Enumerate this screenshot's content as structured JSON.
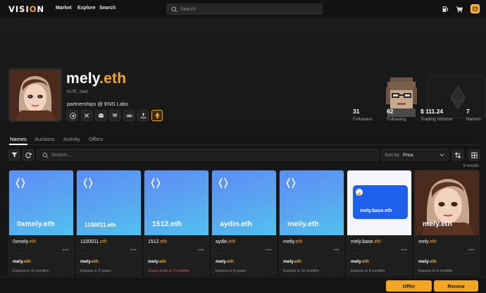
{
  "nav": {
    "logo_prefix": "VISI",
    "logo_o": "O",
    "logo_suffix": "N",
    "links": [
      "Market",
      "Explore",
      "Search"
    ],
    "search_placeholder": "Search",
    "icons": [
      "gas-icon",
      "cart-icon",
      "wallet-icon"
    ]
  },
  "profile": {
    "name": "mely",
    "tld": ".eth",
    "address": "0x7ff...2bef",
    "bio": "partnerships @ ENS Labs",
    "socials": [
      "telegram-icon",
      "x-icon",
      "discord-icon",
      "warpcast-icon",
      "link-icon",
      "share-icon",
      "ethereum-icon"
    ],
    "social_glyphs": [
      "W"
    ]
  },
  "stats": [
    {
      "value": "31",
      "label": "Followers"
    },
    {
      "value": "62",
      "label": "Following"
    },
    {
      "value": "$ 111.24",
      "label": "Trading Volume"
    },
    {
      "value": "7",
      "label": "Names"
    }
  ],
  "tabs": [
    "Names",
    "Auctions",
    "Activity",
    "Offers"
  ],
  "active_tab": "Names",
  "toolbar": {
    "search_placeholder": "Search...",
    "sort_label": "Sort by:",
    "sort_value": "Price"
  },
  "results_text": "9 results",
  "cards": [
    {
      "image_label": "0xmely.eth",
      "name": "0xmely",
      "tld": ".eth",
      "owner": "mely",
      "owner_tld": ".eth",
      "expiry": "Expires in 11 months",
      "grace": false
    },
    {
      "image_label": "1100011.eth",
      "name": "1100011",
      "tld": ".eth",
      "owner": "mely",
      "owner_tld": ".eth",
      "expiry": "Expires in 2 years",
      "grace": false
    },
    {
      "image_label": "1512.eth",
      "name": "1512",
      "tld": ".eth",
      "owner": "mely",
      "owner_tld": ".eth",
      "expiry": "Grace ends in 3 months",
      "grace": true
    },
    {
      "image_label": "aydin.eth",
      "name": "aydin",
      "tld": ".eth",
      "owner": "mely",
      "owner_tld": ".eth",
      "expiry": "Expires in 8 years",
      "grace": false
    },
    {
      "image_label": "meily.eth",
      "name": "meily",
      "tld": ".eth",
      "owner": "mely",
      "owner_tld": ".eth",
      "expiry": "Expires in 11 months",
      "grace": false
    },
    {
      "image_label": "mely.base.eth",
      "name": "mely.base",
      "tld": ".eth",
      "owner": "mely",
      "owner_tld": ".eth",
      "expiry": "Expires in 5 months",
      "grace": false
    },
    {
      "image_label": "mely.eth",
      "name": "mely",
      "tld": ".eth",
      "owner": "mely",
      "owner_tld": ".eth",
      "expiry": "Expires in 9 months",
      "grace": false
    }
  ],
  "bottom": {
    "offer_label": "Offer",
    "renew_label": "Renew"
  },
  "colors": {
    "accent": "#f5a524",
    "card_gradient_start": "#5b8cf8",
    "card_gradient_end": "#4fc3ee",
    "grace": "#f05a5a",
    "base_blue": "#1f5fee"
  }
}
